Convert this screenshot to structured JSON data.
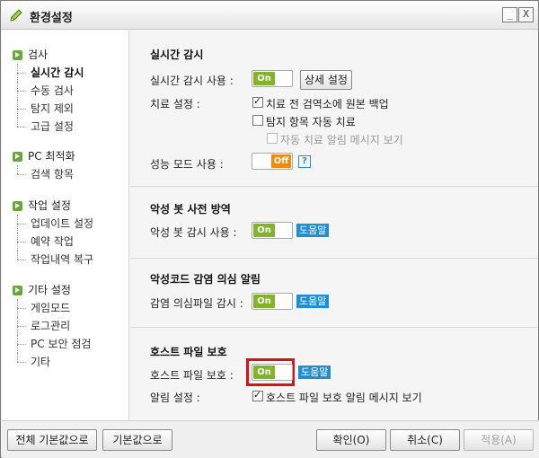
{
  "window": {
    "title": "환경설정",
    "min_label": "_",
    "close_label": "X"
  },
  "sidebar": {
    "groups": [
      {
        "label": "검사",
        "items": [
          "실시간 감시",
          "수동 검사",
          "탐지 제외",
          "고급 설정"
        ]
      },
      {
        "label": "PC 최적화",
        "items": [
          "검색 항목"
        ]
      },
      {
        "label": "작업 설정",
        "items": [
          "업데이트 설정",
          "예약 작업",
          "작업내역 복구"
        ]
      },
      {
        "label": "기타 설정",
        "items": [
          "게임모드",
          "로그관리",
          "PC 보안 점검",
          "기타"
        ]
      }
    ],
    "active_item": "실시간 감시"
  },
  "realtime": {
    "title": "실시간 감시",
    "monitor_label": "실시간 감시 사용 :",
    "monitor_state": "On",
    "detail_button": "상세 설정",
    "cure_label": "치료 설정 :",
    "backup_label": "치료 전 검역소에 원본 백업",
    "backup_checked": true,
    "autocure_label": "탐지 항목 자동 치료",
    "autocure_checked": false,
    "alert_label": "자동 치료 알림 메시지 보기",
    "alert_checked": false,
    "perf_label": "성능 모드 사용 :",
    "perf_state": "Off",
    "help_q": "?"
  },
  "malbot": {
    "title": "악성 봇 사전 방역",
    "monitor_label": "악성 봇 감시 사용 :",
    "state": "On",
    "help": "도움말"
  },
  "infection": {
    "title": "악성코드 감염 의심 알림",
    "monitor_label": "감염 의심파일 감시 :",
    "state": "On",
    "help": "도움말"
  },
  "hosts": {
    "title": "호스트 파일 보호",
    "protect_label": "호스트 파일 보호 :",
    "state": "On",
    "help": "도움말",
    "alert_setting_label": "알림 설정 :",
    "alert_label": "호스트 파일 보호 알림 메시지 보기",
    "alert_checked": true
  },
  "footer": {
    "reset_all": "전체 기본값으로",
    "reset": "기본값으로",
    "ok": "확인(O)",
    "cancel": "취소(C)",
    "apply": "적용(A)"
  },
  "colors": {
    "toggle_on": "#7fb526",
    "toggle_off": "#f08a12",
    "help_badge": "#1e8fd6",
    "highlight": "#e01010",
    "nav_bullet": "#6aa63a"
  }
}
